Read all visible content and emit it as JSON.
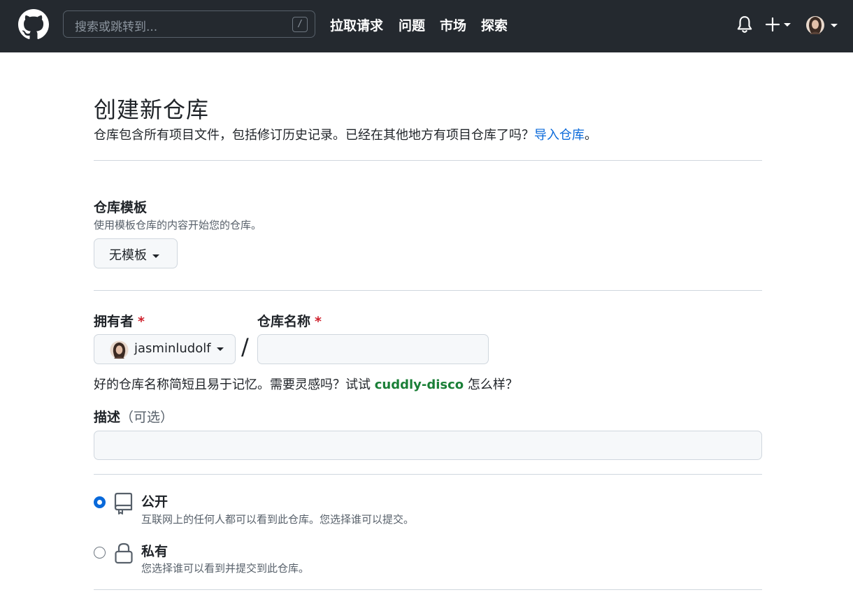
{
  "header": {
    "search_placeholder": "搜索或跳转到...",
    "search_shortcut": "/",
    "nav": [
      "拉取请求",
      "问题",
      "市场",
      "探索"
    ],
    "bell_icon": "bell-icon",
    "plus_icon": "plus-icon",
    "colors": {
      "background": "#24292f",
      "text": "#ffffff"
    }
  },
  "page": {
    "title": "创建新仓库",
    "lead_text": "仓库包含所有项目文件，包括修订历史记录。已经在其他地方有项目仓库了吗？",
    "import_link": "导入仓库",
    "lead_end": "。"
  },
  "template": {
    "label": "仓库模板",
    "note": "使用模板仓库的内容开始您的仓库。",
    "selected": "无模板"
  },
  "owner": {
    "label": "拥有者",
    "required": "*",
    "selected": "jasminludolf"
  },
  "repo_name": {
    "label": "仓库名称",
    "required": "*",
    "value": "",
    "separator": "/"
  },
  "name_hint": {
    "text": "好的仓库名称简短且易于记忆。需要灵感吗？试试 ",
    "suggestion": "cuddly-disco",
    "suffix": " 怎么样？"
  },
  "description": {
    "label": "描述",
    "optional": "（可选）",
    "value": ""
  },
  "visibility": [
    {
      "title": "公开",
      "desc": "互联网上的任何人都可以看到此仓库。您选择谁可以提交。",
      "selected": true,
      "icon": "repo-icon"
    },
    {
      "title": "私有",
      "desc": "您选择谁可以看到并提交到此仓库。",
      "selected": false,
      "icon": "lock-icon"
    }
  ],
  "colors": {
    "accent": "#0969da",
    "required": "#cf222e",
    "suggestion": "#1a7f37",
    "border": "#d0d7de"
  }
}
